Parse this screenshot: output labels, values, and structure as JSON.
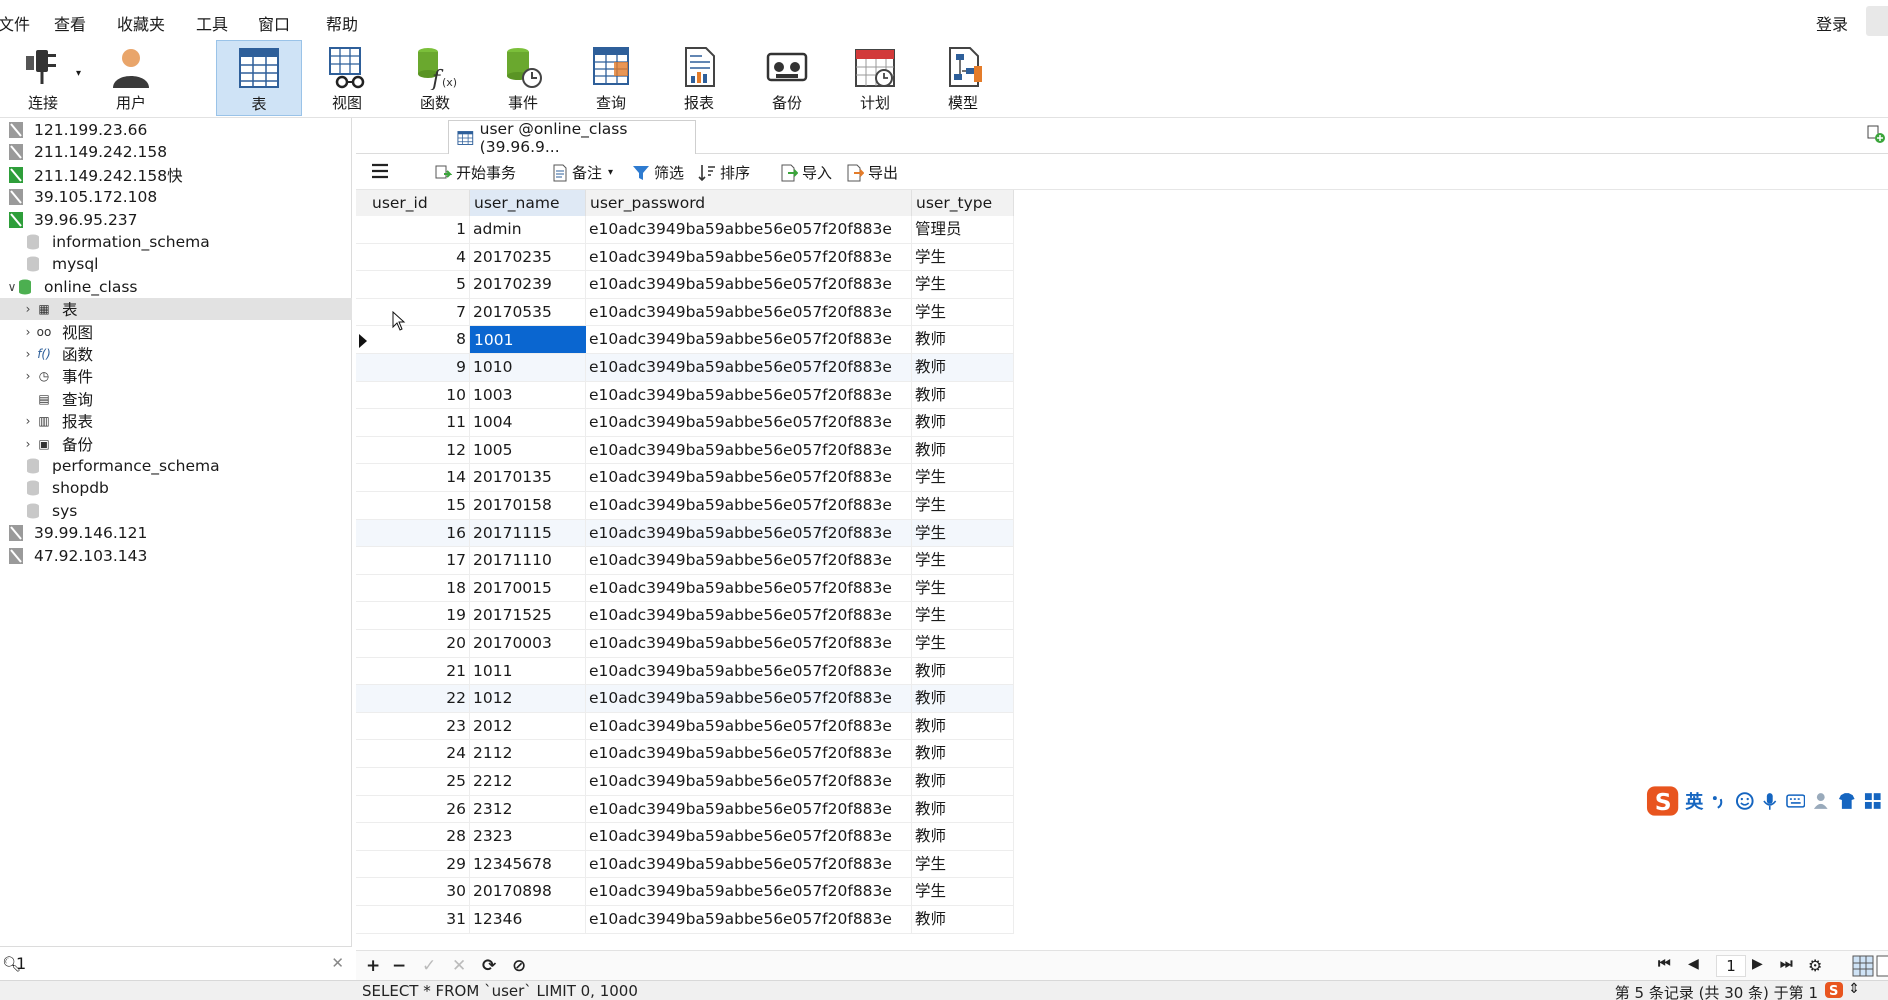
{
  "menu": {
    "file": "文件",
    "view": "查看",
    "favorites": "收藏夹",
    "tools": "工具",
    "window": "窗口",
    "help": "帮助",
    "login": "登录"
  },
  "toolbar": {
    "connect": "连接",
    "user": "用户",
    "table": "表",
    "view": "视图",
    "function": "函数",
    "event": "事件",
    "query": "查询",
    "report": "报表",
    "backup": "备份",
    "schedule": "计划",
    "model": "模型"
  },
  "tree": {
    "connections_top": [
      {
        "label": "121.199.23.66",
        "active": false
      },
      {
        "label": "211.149.242.158",
        "active": false
      },
      {
        "label": "211.149.242.158快",
        "active": true
      },
      {
        "label": "39.105.172.108",
        "active": false
      },
      {
        "label": "39.96.95.237",
        "active": true
      }
    ],
    "databases_before": [
      "information_schema",
      "mysql"
    ],
    "open_db": "online_class",
    "objects": [
      {
        "label": "表",
        "icon": "table-icon",
        "expander": true
      },
      {
        "label": "视图",
        "icon": "view-icon",
        "expander": true
      },
      {
        "label": "函数",
        "icon": "function-icon",
        "expander": true
      },
      {
        "label": "事件",
        "icon": "event-icon",
        "expander": true
      },
      {
        "label": "查询",
        "icon": "query-icon",
        "expander": false
      },
      {
        "label": "报表",
        "icon": "report-icon",
        "expander": true
      },
      {
        "label": "备份",
        "icon": "backup-icon",
        "expander": true
      }
    ],
    "databases_after": [
      "performance_schema",
      "shopdb",
      "sys"
    ],
    "connections_bottom": [
      {
        "label": "39.99.146.121"
      },
      {
        "label": "47.92.103.143"
      }
    ]
  },
  "search": {
    "value": "1"
  },
  "tab": {
    "label": "user @online_class (39.96.9..."
  },
  "grid_toolbar": {
    "begin_transaction": "开始事务",
    "note": "备注",
    "filter": "筛选",
    "sort": "排序",
    "import": "导入",
    "export": "导出"
  },
  "grid": {
    "columns": [
      "user_id",
      "user_name",
      "user_password",
      "user_type"
    ],
    "rows": [
      [
        "1",
        "admin",
        "e10adc3949ba59abbe56e057f20f883e",
        "管理员"
      ],
      [
        "4",
        "20170235",
        "e10adc3949ba59abbe56e057f20f883e",
        "学生"
      ],
      [
        "5",
        "20170239",
        "e10adc3949ba59abbe56e057f20f883e",
        "学生"
      ],
      [
        "7",
        "20170535",
        "e10adc3949ba59abbe56e057f20f883e",
        "学生"
      ],
      [
        "8",
        "1001",
        "e10adc3949ba59abbe56e057f20f883e",
        "教师"
      ],
      [
        "9",
        "1010",
        "e10adc3949ba59abbe56e057f20f883e",
        "教师"
      ],
      [
        "10",
        "1003",
        "e10adc3949ba59abbe56e057f20f883e",
        "教师"
      ],
      [
        "11",
        "1004",
        "e10adc3949ba59abbe56e057f20f883e",
        "教师"
      ],
      [
        "12",
        "1005",
        "e10adc3949ba59abbe56e057f20f883e",
        "教师"
      ],
      [
        "14",
        "20170135",
        "e10adc3949ba59abbe56e057f20f883e",
        "学生"
      ],
      [
        "15",
        "20170158",
        "e10adc3949ba59abbe56e057f20f883e",
        "学生"
      ],
      [
        "16",
        "20171115",
        "e10adc3949ba59abbe56e057f20f883e",
        "学生"
      ],
      [
        "17",
        "20171110",
        "e10adc3949ba59abbe56e057f20f883e",
        "学生"
      ],
      [
        "18",
        "20170015",
        "e10adc3949ba59abbe56e057f20f883e",
        "学生"
      ],
      [
        "19",
        "20171525",
        "e10adc3949ba59abbe56e057f20f883e",
        "学生"
      ],
      [
        "20",
        "20170003",
        "e10adc3949ba59abbe56e057f20f883e",
        "学生"
      ],
      [
        "21",
        "1011",
        "e10adc3949ba59abbe56e057f20f883e",
        "教师"
      ],
      [
        "22",
        "1012",
        "e10adc3949ba59abbe56e057f20f883e",
        "教师"
      ],
      [
        "23",
        "2012",
        "e10adc3949ba59abbe56e057f20f883e",
        "教师"
      ],
      [
        "24",
        "2112",
        "e10adc3949ba59abbe56e057f20f883e",
        "教师"
      ],
      [
        "25",
        "2212",
        "e10adc3949ba59abbe56e057f20f883e",
        "教师"
      ],
      [
        "26",
        "2312",
        "e10adc3949ba59abbe56e057f20f883e",
        "教师"
      ],
      [
        "28",
        "2323",
        "e10adc3949ba59abbe56e057f20f883e",
        "教师"
      ],
      [
        "29",
        "12345678",
        "e10adc3949ba59abbe56e057f20f883e",
        "学生"
      ],
      [
        "30",
        "20170898",
        "e10adc3949ba59abbe56e057f20f883e",
        "学生"
      ],
      [
        "31",
        "12346",
        "e10adc3949ba59abbe56e057f20f883e",
        "教师"
      ]
    ],
    "selected_row_index": 4
  },
  "ime": {
    "lang": "英"
  },
  "pager": {
    "page": "1"
  },
  "status": {
    "sql": "SELECT * FROM `user` LIMIT 0, 1000",
    "record": "第 5 条记录 (共 30 条) 于第 1"
  },
  "colors": {
    "accent": "#0a66d0",
    "toolbar_active": "#cfe3f6",
    "connection_active": "#2e9e3a",
    "connection_inactive": "#9a9a9a",
    "ime_brand": "#e8541e"
  }
}
